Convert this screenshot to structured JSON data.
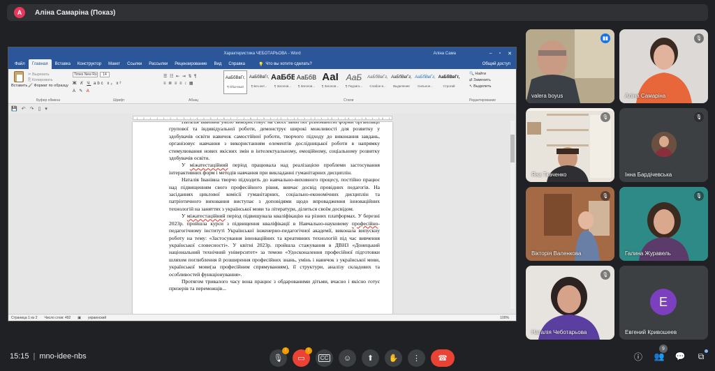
{
  "presenter": {
    "avatar_letter": "А",
    "name": "Аліна Самаріна (Показ)"
  },
  "word": {
    "doc_title": "Характеристика ЧЕБОТАРЬОВА  -  Word",
    "user_name": "Аліна Сама",
    "tabs": [
      "Файл",
      "Главная",
      "Вставка",
      "Конструктор",
      "Макет",
      "Ссылки",
      "Рассылки",
      "Рецензирование",
      "Вид",
      "Справка"
    ],
    "tell_me": "Что вы хотите сделать?",
    "share": "Общий доступ",
    "ribbon": {
      "paste": "Вставить",
      "cut": "Вырезать",
      "copy": "Копировать",
      "format_painter": "Формат по образцу",
      "clipboard_group": "Буфер обмена",
      "font_name": "Times New Ro",
      "font_size": "14",
      "font_group": "Шрифт",
      "paragraph_group": "Абзац",
      "styles_group": "Стили",
      "editing_group": "Редактирование",
      "find": "Найти",
      "replace": "Заменить",
      "select": "Выделить",
      "styles": [
        {
          "sample": "АаБбВвГг,",
          "name": "¶ Обычный"
        },
        {
          "sample": "АаБбВвГг,",
          "name": "¶ Без инт..."
        },
        {
          "sample": "АаБбВ",
          "name": "¶ Заголов..."
        },
        {
          "sample": "АаБбВ",
          "name": "¶ Заголов..."
        },
        {
          "sample": "АаІ",
          "name": "¶ Заголов..."
        },
        {
          "sample": "АаБ",
          "name": "¶ Подзаго..."
        },
        {
          "sample": "АаБбВвГг,",
          "name": "Слабое в..."
        },
        {
          "sample": "АаБбВвГг,",
          "name": "Выделение"
        },
        {
          "sample": "АаБбВвГг,",
          "name": "Сильное..."
        },
        {
          "sample": "АаБбВвГг,",
          "name": "Строгий"
        }
      ]
    },
    "doc": {
      "p0": "Наталія Іванівна уміло використовує на своїх заняттях різноманітні форми організації групової та індивідуальної роботи, демонструє широкі можливості для розвитку у здобувачів освіти навичок самостійної роботи, творчого підходу до виконання завдань, організовує навчання з використанням елементів дослідницької роботи в напрямку стимулювання нових якісних змін в інтелектуальному, емоційному, соціальному розвитку здобувачів освіти.",
      "p1_pre": "У ",
      "p1_word": "міжатестаційний",
      "p1_post": " період працювала над реалізацією проблеми застосування інтерактивних форм і  методів навчання при викладанні гуманітарних дисциплін.",
      "p2": "Наталія Іванівна творчо підходить до навчально-виховного процесу, постійно працює над підвищенням свого професійного рівня, вивчає досвід провідних педагогів. На засіданнях циклової комісії гуманітарних, соціально-економічних дисциплін та патріотичного виховання  виступає з доповідями щодо впровадження інноваційних технологій на заняттях з української мови та літератури, ділиться своїм досвідом.",
      "p3_pre": "У ",
      "p3_word": "міжатестаційний",
      "p3_mid": " період  підвищувала кваліфікацію на різних платформах. У березні 2023р. пройшла курси з підвищення кваліфікації в Навчально-науковому ",
      "p3_word2": "професійно",
      "p3_post": "-педагогічному інституті Української інженерно-педагогічної академії, виконала випускну роботу на тему: «Застосування  інноваційних та креативних технологій під час вивчення української словесності». У квітні 2023р. пройшла стажування в  ДВНЗ «Донецький національний технічний університет» за темою «Удосконалення професійної підготовки шляхом поглиблення й розширення професійних знань, умінь і навичок з української мови, української мови(за професійним спрямуванням), її структури, аналізу складових та особливостей функціонування».",
      "p4": "Протягом тривалого часу вона працює з обдарованими дітьми, вчасно і якісно готує призерів та переможців..."
    },
    "status": {
      "page": "Страница 1 из 2",
      "words": "Число слов: 492",
      "lang": "украинский",
      "zoom": "100%"
    }
  },
  "participants": [
    {
      "name": "valera boyus",
      "state": "speaking"
    },
    {
      "name": "Аліна Самаріна",
      "state": "muted"
    },
    {
      "name": "Яна Ткаченко",
      "state": "muted"
    },
    {
      "name": "Інна Бардічевська",
      "state": "muted"
    },
    {
      "name": "Вікторія Валенкова",
      "state": "muted"
    },
    {
      "name": "Галина Журавель",
      "state": "muted"
    },
    {
      "name": "Наталія Чеботарьова",
      "state": "muted"
    },
    {
      "name": "Евгений Кривошеев",
      "state": "muted",
      "avatar_letter": "E",
      "avatar_color": "#7b3fbf"
    }
  ],
  "bottom": {
    "time": "15:15",
    "meeting_code": "mno-idee-nbs",
    "people_count": "9",
    "mic_badge": "!",
    "cam_badge": "!"
  }
}
